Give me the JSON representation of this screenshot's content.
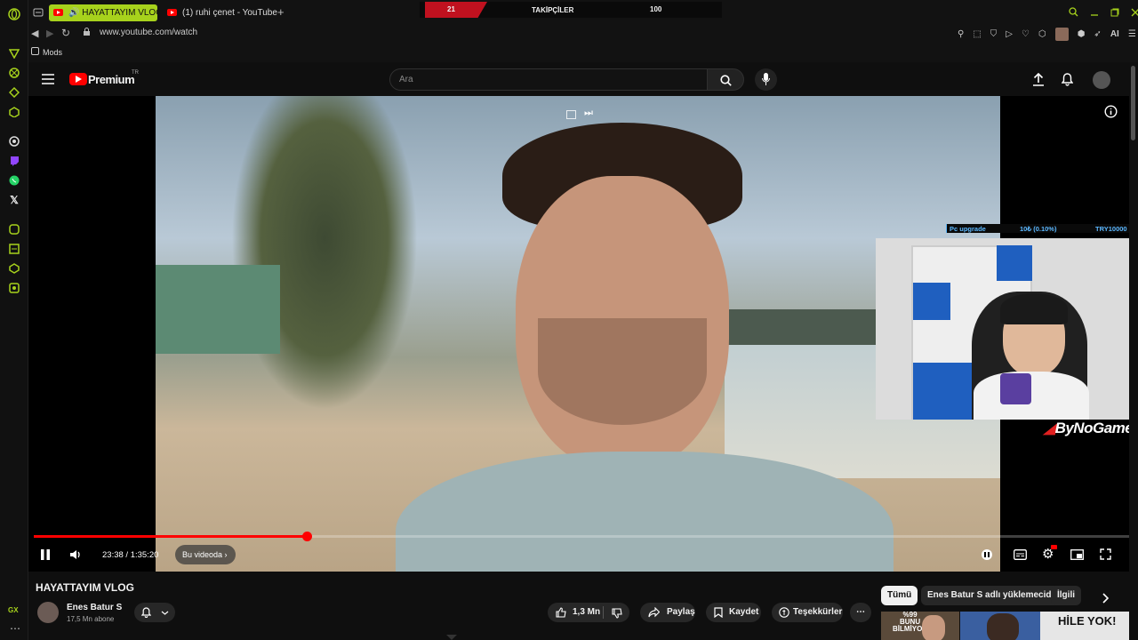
{
  "browser": {
    "tabs": [
      {
        "label": "HAYATTAYIM VLOG -",
        "active": true
      },
      {
        "label": "(1) ruhi çenet - YouTube",
        "active": false
      }
    ],
    "url": "www.youtube.com/watch",
    "bookmark": "Mods",
    "aria_label": "AI",
    "sidebar_bottom": "GX"
  },
  "stream_overlay": {
    "left_count": "21",
    "title": "TAKİPÇİLER",
    "right_count": "100",
    "goal_left": "Pc upgrade",
    "goal_mid": "10₺ (0.10%)",
    "goal_right": "TRY10000",
    "brand": "ByNoGame"
  },
  "youtube": {
    "logo_text": "Premium",
    "logo_region": "TR",
    "search_placeholder": "Ara",
    "player": {
      "time": "23:38 / 1:35:20",
      "chapter": "Bu videoda",
      "progress": 0.248
    },
    "video_title": "HAYATTAYIM VLOG",
    "channel": {
      "name": "Enes Batur S",
      "subs": "17,5 Mn abone"
    },
    "actions": {
      "likes": "1,3 Mn",
      "share": "Paylaş",
      "save": "Kaydet",
      "thanks": "Teşekkürler"
    },
    "chips": [
      "Tümü",
      "Enes Batur S adlı yüklemeciden",
      "İlgili"
    ],
    "thumb_texts": [
      "%99",
      "BUNU",
      "BİLMİYOR",
      "HİLE YOK!"
    ]
  },
  "colors": {
    "accent": "#a7d21c",
    "yt_red": "#ff0000",
    "overlay_red": "#c0111f"
  }
}
